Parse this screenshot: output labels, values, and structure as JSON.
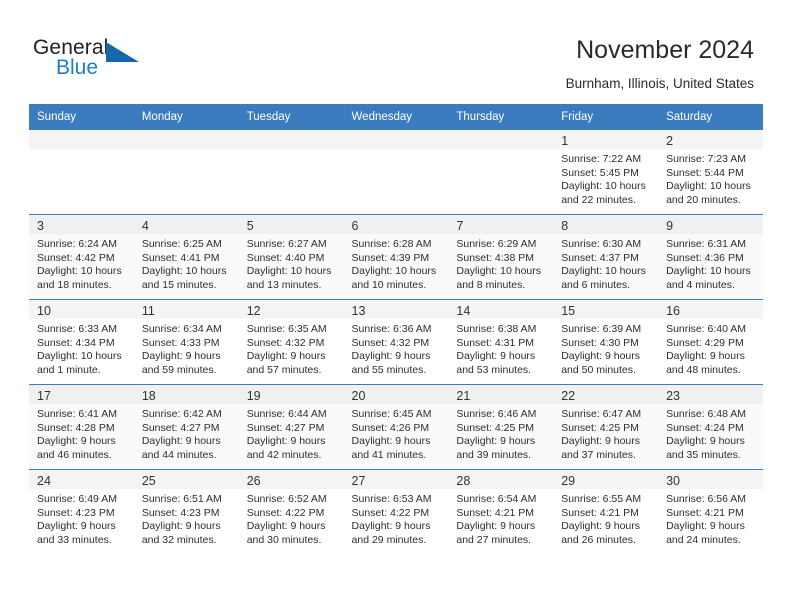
{
  "logo": {
    "text_top": "General",
    "text_bottom": "Blue",
    "flag_icon": "blue-triangle-flag-icon",
    "color_dark": "#231f20",
    "color_blue": "#1b7fc4"
  },
  "header": {
    "title": "November 2024",
    "subtitle": "Burnham, Illinois, United States"
  },
  "colors": {
    "header_row_bg": "#3a7cbe",
    "header_row_text": "#ffffff",
    "daynum_bar_bg": "#f4f4f4",
    "shaded_row_bg": "#fafafa",
    "grid_line": "#3a7cbe"
  },
  "calendar": {
    "weekday_headers": [
      "Sunday",
      "Monday",
      "Tuesday",
      "Wednesday",
      "Thursday",
      "Friday",
      "Saturday"
    ],
    "weeks": [
      {
        "shaded": false,
        "days": [
          {
            "day": "",
            "lines": []
          },
          {
            "day": "",
            "lines": []
          },
          {
            "day": "",
            "lines": []
          },
          {
            "day": "",
            "lines": []
          },
          {
            "day": "",
            "lines": []
          },
          {
            "day": "1",
            "lines": [
              "Sunrise: 7:22 AM",
              "Sunset: 5:45 PM",
              "Daylight: 10 hours",
              "and 22 minutes."
            ]
          },
          {
            "day": "2",
            "lines": [
              "Sunrise: 7:23 AM",
              "Sunset: 5:44 PM",
              "Daylight: 10 hours",
              "and 20 minutes."
            ]
          }
        ]
      },
      {
        "shaded": true,
        "days": [
          {
            "day": "3",
            "lines": [
              "Sunrise: 6:24 AM",
              "Sunset: 4:42 PM",
              "Daylight: 10 hours",
              "and 18 minutes."
            ]
          },
          {
            "day": "4",
            "lines": [
              "Sunrise: 6:25 AM",
              "Sunset: 4:41 PM",
              "Daylight: 10 hours",
              "and 15 minutes."
            ]
          },
          {
            "day": "5",
            "lines": [
              "Sunrise: 6:27 AM",
              "Sunset: 4:40 PM",
              "Daylight: 10 hours",
              "and 13 minutes."
            ]
          },
          {
            "day": "6",
            "lines": [
              "Sunrise: 6:28 AM",
              "Sunset: 4:39 PM",
              "Daylight: 10 hours",
              "and 10 minutes."
            ]
          },
          {
            "day": "7",
            "lines": [
              "Sunrise: 6:29 AM",
              "Sunset: 4:38 PM",
              "Daylight: 10 hours",
              "and 8 minutes."
            ]
          },
          {
            "day": "8",
            "lines": [
              "Sunrise: 6:30 AM",
              "Sunset: 4:37 PM",
              "Daylight: 10 hours",
              "and 6 minutes."
            ]
          },
          {
            "day": "9",
            "lines": [
              "Sunrise: 6:31 AM",
              "Sunset: 4:36 PM",
              "Daylight: 10 hours",
              "and 4 minutes."
            ]
          }
        ]
      },
      {
        "shaded": false,
        "days": [
          {
            "day": "10",
            "lines": [
              "Sunrise: 6:33 AM",
              "Sunset: 4:34 PM",
              "Daylight: 10 hours",
              "and 1 minute."
            ]
          },
          {
            "day": "11",
            "lines": [
              "Sunrise: 6:34 AM",
              "Sunset: 4:33 PM",
              "Daylight: 9 hours",
              "and 59 minutes."
            ]
          },
          {
            "day": "12",
            "lines": [
              "Sunrise: 6:35 AM",
              "Sunset: 4:32 PM",
              "Daylight: 9 hours",
              "and 57 minutes."
            ]
          },
          {
            "day": "13",
            "lines": [
              "Sunrise: 6:36 AM",
              "Sunset: 4:32 PM",
              "Daylight: 9 hours",
              "and 55 minutes."
            ]
          },
          {
            "day": "14",
            "lines": [
              "Sunrise: 6:38 AM",
              "Sunset: 4:31 PM",
              "Daylight: 9 hours",
              "and 53 minutes."
            ]
          },
          {
            "day": "15",
            "lines": [
              "Sunrise: 6:39 AM",
              "Sunset: 4:30 PM",
              "Daylight: 9 hours",
              "and 50 minutes."
            ]
          },
          {
            "day": "16",
            "lines": [
              "Sunrise: 6:40 AM",
              "Sunset: 4:29 PM",
              "Daylight: 9 hours",
              "and 48 minutes."
            ]
          }
        ]
      },
      {
        "shaded": true,
        "days": [
          {
            "day": "17",
            "lines": [
              "Sunrise: 6:41 AM",
              "Sunset: 4:28 PM",
              "Daylight: 9 hours",
              "and 46 minutes."
            ]
          },
          {
            "day": "18",
            "lines": [
              "Sunrise: 6:42 AM",
              "Sunset: 4:27 PM",
              "Daylight: 9 hours",
              "and 44 minutes."
            ]
          },
          {
            "day": "19",
            "lines": [
              "Sunrise: 6:44 AM",
              "Sunset: 4:27 PM",
              "Daylight: 9 hours",
              "and 42 minutes."
            ]
          },
          {
            "day": "20",
            "lines": [
              "Sunrise: 6:45 AM",
              "Sunset: 4:26 PM",
              "Daylight: 9 hours",
              "and 41 minutes."
            ]
          },
          {
            "day": "21",
            "lines": [
              "Sunrise: 6:46 AM",
              "Sunset: 4:25 PM",
              "Daylight: 9 hours",
              "and 39 minutes."
            ]
          },
          {
            "day": "22",
            "lines": [
              "Sunrise: 6:47 AM",
              "Sunset: 4:25 PM",
              "Daylight: 9 hours",
              "and 37 minutes."
            ]
          },
          {
            "day": "23",
            "lines": [
              "Sunrise: 6:48 AM",
              "Sunset: 4:24 PM",
              "Daylight: 9 hours",
              "and 35 minutes."
            ]
          }
        ]
      },
      {
        "shaded": false,
        "days": [
          {
            "day": "24",
            "lines": [
              "Sunrise: 6:49 AM",
              "Sunset: 4:23 PM",
              "Daylight: 9 hours",
              "and 33 minutes."
            ]
          },
          {
            "day": "25",
            "lines": [
              "Sunrise: 6:51 AM",
              "Sunset: 4:23 PM",
              "Daylight: 9 hours",
              "and 32 minutes."
            ]
          },
          {
            "day": "26",
            "lines": [
              "Sunrise: 6:52 AM",
              "Sunset: 4:22 PM",
              "Daylight: 9 hours",
              "and 30 minutes."
            ]
          },
          {
            "day": "27",
            "lines": [
              "Sunrise: 6:53 AM",
              "Sunset: 4:22 PM",
              "Daylight: 9 hours",
              "and 29 minutes."
            ]
          },
          {
            "day": "28",
            "lines": [
              "Sunrise: 6:54 AM",
              "Sunset: 4:21 PM",
              "Daylight: 9 hours",
              "and 27 minutes."
            ]
          },
          {
            "day": "29",
            "lines": [
              "Sunrise: 6:55 AM",
              "Sunset: 4:21 PM",
              "Daylight: 9 hours",
              "and 26 minutes."
            ]
          },
          {
            "day": "30",
            "lines": [
              "Sunrise: 6:56 AM",
              "Sunset: 4:21 PM",
              "Daylight: 9 hours",
              "and 24 minutes."
            ]
          }
        ]
      }
    ]
  }
}
